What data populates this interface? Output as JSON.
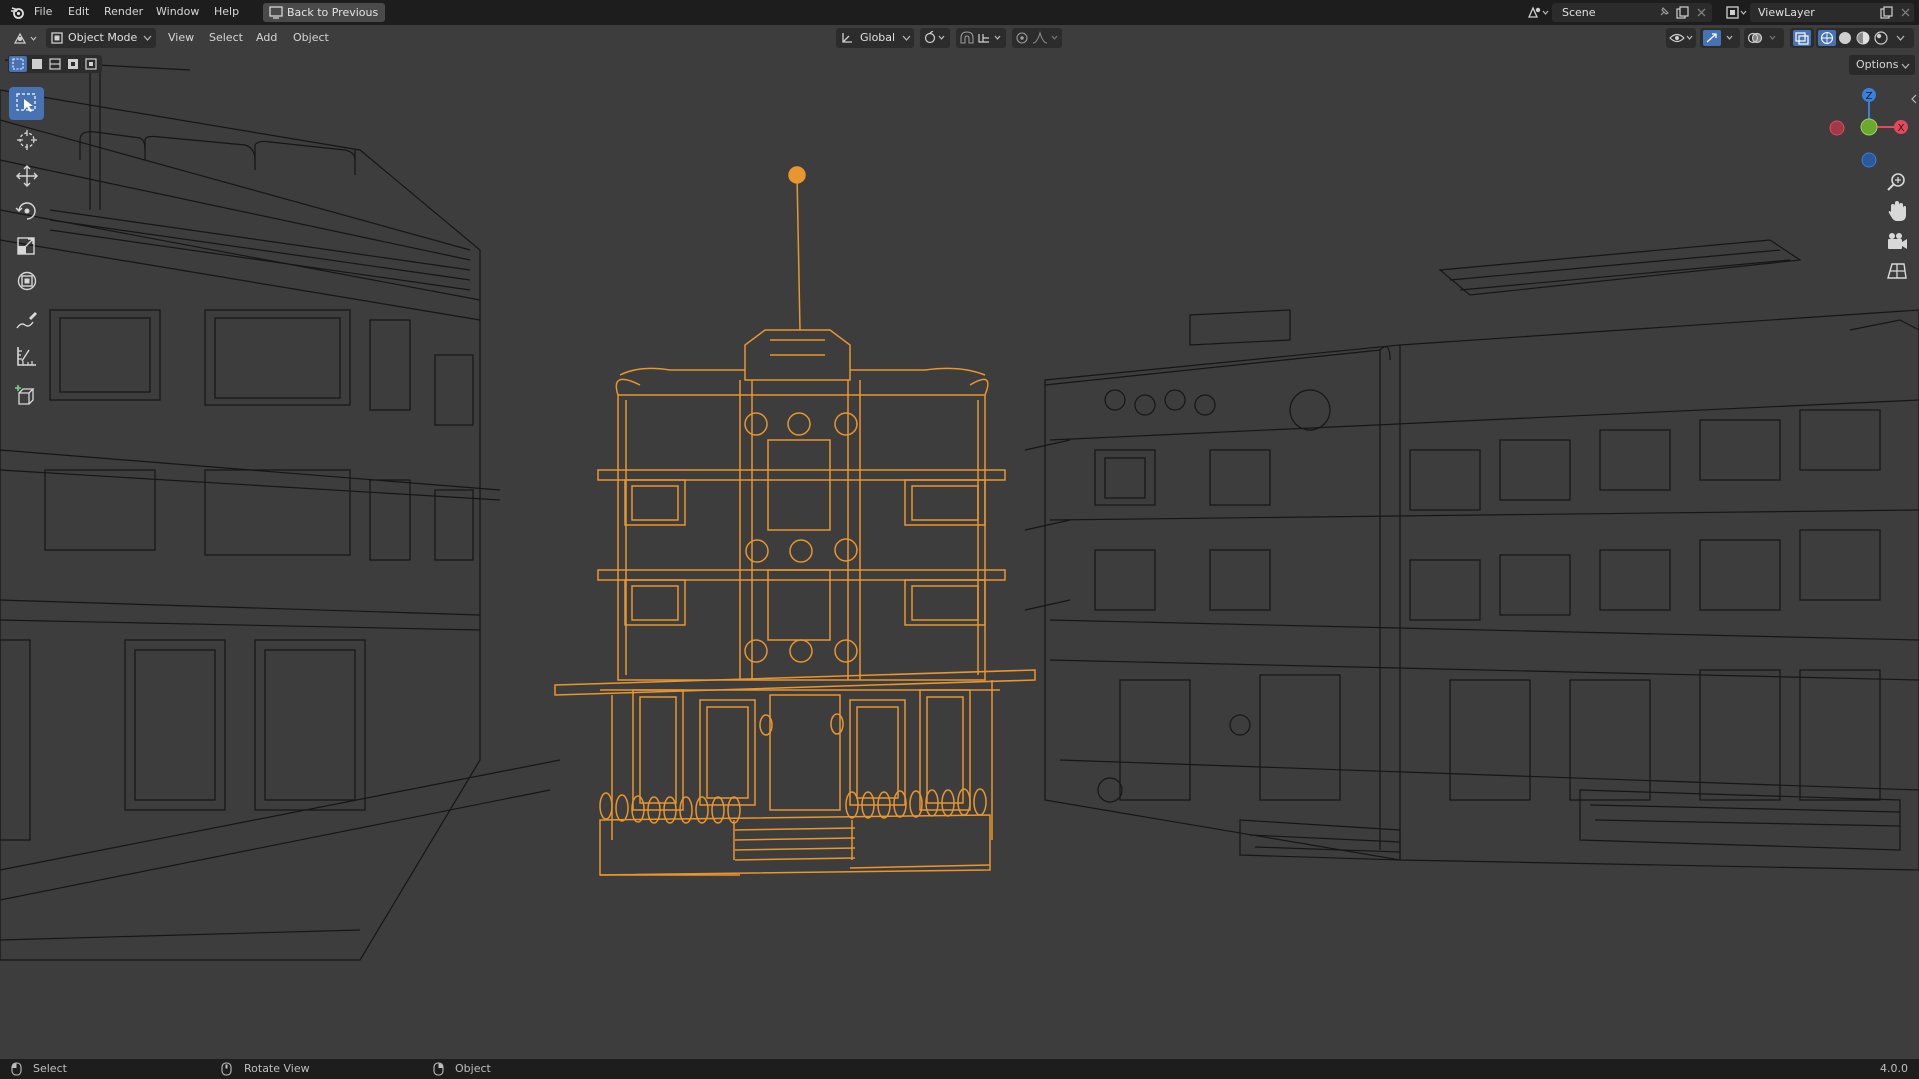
{
  "menu": {
    "items": [
      "File",
      "Edit",
      "Render",
      "Window",
      "Help"
    ],
    "back_label": "Back to Previous"
  },
  "scene": {
    "label": "Scene"
  },
  "view_layer": {
    "label": "ViewLayer"
  },
  "header": {
    "mode_label": "Object Mode",
    "menus": [
      "View",
      "Select",
      "Add",
      "Object"
    ],
    "orientation_label": "Global",
    "options_label": "Options"
  },
  "gizmo": {
    "z_label": "Z",
    "x_label": "X"
  },
  "status": {
    "select_label": "Select",
    "rotate_label": "Rotate View",
    "object_label": "Object",
    "version": "4.0.0"
  },
  "colors": {
    "selected_wire": "#e8962e",
    "unselected_wire": "#0e0e0e",
    "viewport_bg": "#3d3d3d",
    "active_tool": "#4772b3",
    "axis_x": "#e04a5c",
    "axis_y": "#6aa82e",
    "axis_z": "#3a7fd8"
  },
  "icons": {
    "tools": [
      "select-box-icon",
      "cursor-icon",
      "move-icon",
      "rotate-icon",
      "scale-icon",
      "transform-icon",
      "annotate-icon",
      "measure-icon",
      "add-cube-icon"
    ],
    "nav": [
      "zoom-icon",
      "pan-hand-icon",
      "camera-icon",
      "grid-toggle-icon"
    ]
  }
}
